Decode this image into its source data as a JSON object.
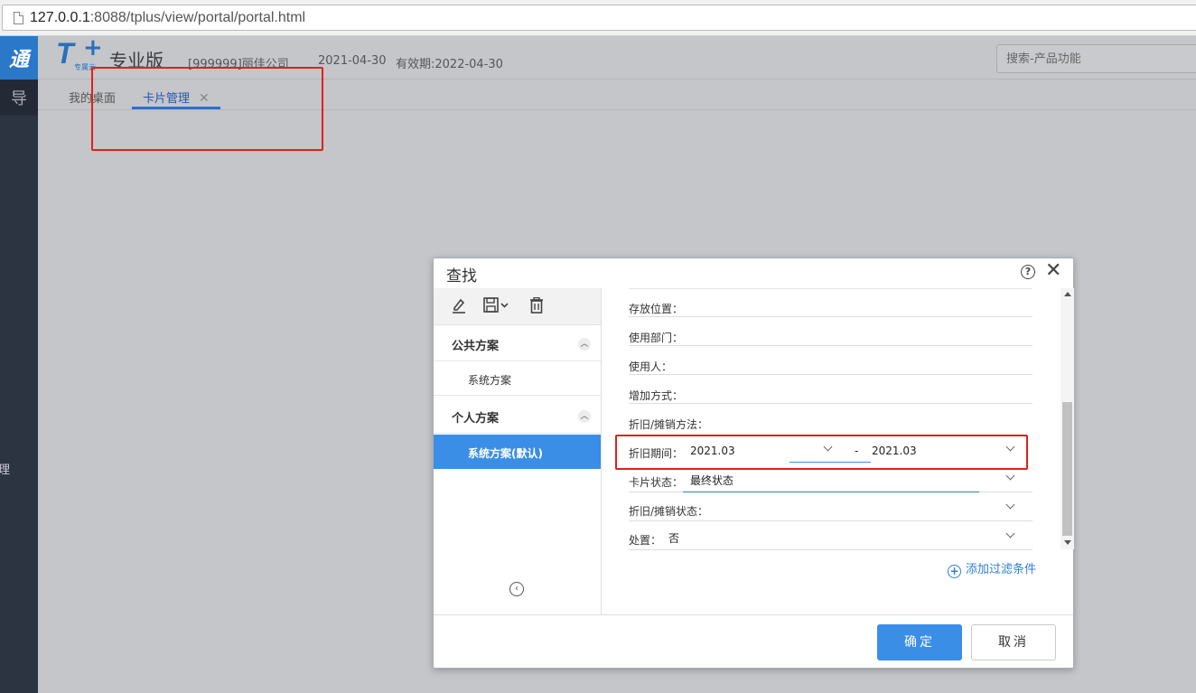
{
  "browser": {
    "url_host": "127.0.0.1",
    "url_rest": ":8088/tplus/view/portal/portal.html"
  },
  "leftbar": {
    "brand_text": "通",
    "sub_text": "导",
    "side_text": "理"
  },
  "header": {
    "logo_letter": "T",
    "logo_plus": "+",
    "logo_cloud": "专属云",
    "edition": "专业版",
    "company": "[999999]丽佳公司",
    "login_date": "2021-04-30",
    "expiry": "有效期:2022-04-30",
    "search_placeholder": "搜索-产品功能"
  },
  "tabs": {
    "desktop": "我的桌面",
    "card_management": "卡片管理",
    "close_glyph": "✕"
  },
  "modal": {
    "title": "查找",
    "help_glyph": "?",
    "close_glyph": "✕",
    "scheme_groups": {
      "public": {
        "label": "公共方案",
        "items": [
          "系统方案"
        ]
      },
      "personal": {
        "label": "个人方案",
        "items": [
          "系统方案(默认)"
        ]
      }
    },
    "filters": {
      "storage_location": {
        "label": "存放位置："
      },
      "department": {
        "label": "使用部门："
      },
      "user": {
        "label": "使用人："
      },
      "add_method": {
        "label": "增加方式："
      },
      "depreciation_method": {
        "label": "折旧/摊销方法："
      },
      "depreciation_period": {
        "label": "折旧期间：",
        "from": "2021.03",
        "separator": "-",
        "to": "2021.03"
      },
      "card_status": {
        "label": "卡片状态：",
        "value": "最终状态"
      },
      "depreciation_status": {
        "label": "折旧/摊销状态："
      },
      "disposal": {
        "label": "处置：",
        "value": "否"
      }
    },
    "add_filter_label": "添加过滤条件",
    "ok_label": "确定",
    "cancel_label": "取消"
  },
  "colors": {
    "primary": "#3a8ee6",
    "highlight_red": "#e0201c",
    "nav_dark": "#2c3441",
    "overlay_gray": "#c4c6ca"
  }
}
